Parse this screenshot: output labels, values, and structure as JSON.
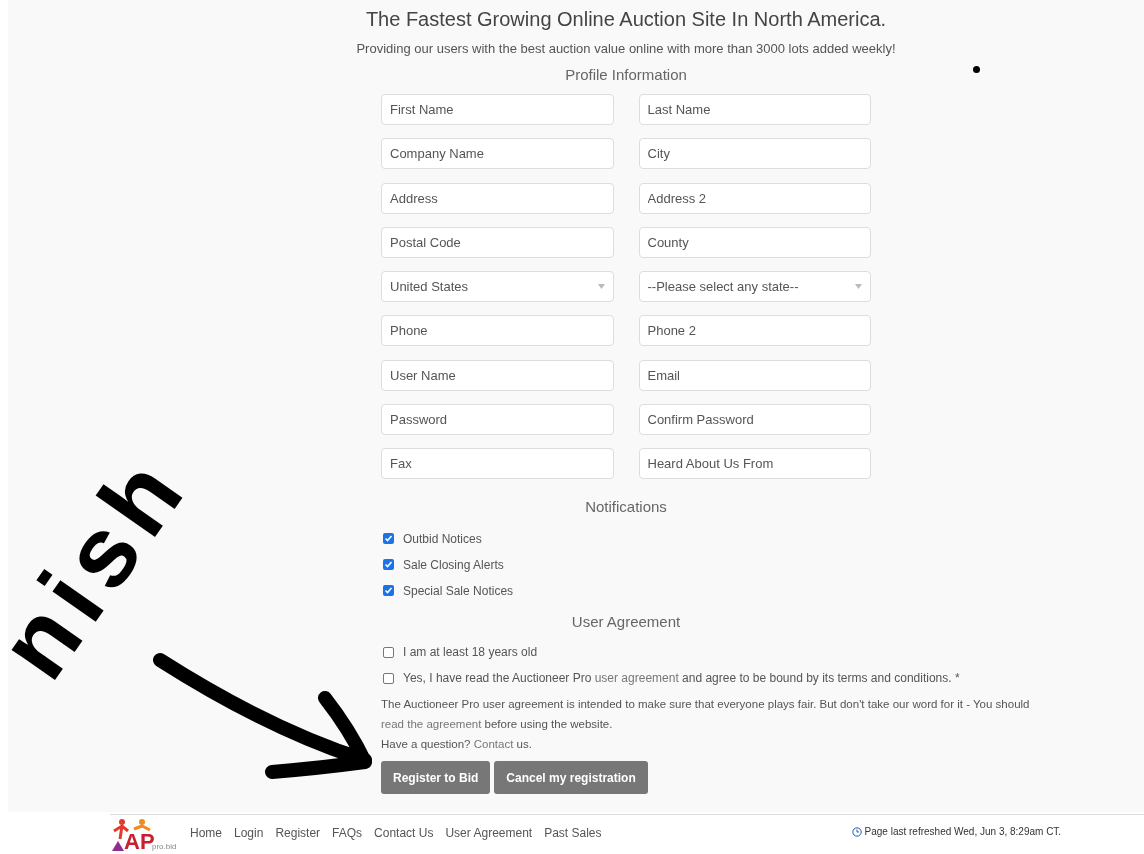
{
  "header": {
    "title": "The Fastest Growing Online Auction Site In North America.",
    "subtitle": "Providing our users with the best auction value online with more than 3000 lots added weekly!"
  },
  "profile": {
    "heading": "Profile Information",
    "fields": [
      {
        "kind": "text",
        "placeholder": "First Name"
      },
      {
        "kind": "text",
        "placeholder": "Last Name"
      },
      {
        "kind": "text",
        "placeholder": "Company Name"
      },
      {
        "kind": "text",
        "placeholder": "City"
      },
      {
        "kind": "text",
        "placeholder": "Address"
      },
      {
        "kind": "text",
        "placeholder": "Address 2"
      },
      {
        "kind": "text",
        "placeholder": "Postal Code"
      },
      {
        "kind": "text",
        "placeholder": "County"
      },
      {
        "kind": "select",
        "value": "United States"
      },
      {
        "kind": "select",
        "value": "--Please select any state--"
      },
      {
        "kind": "text",
        "placeholder": "Phone"
      },
      {
        "kind": "text",
        "placeholder": "Phone 2"
      },
      {
        "kind": "text",
        "placeholder": "User Name"
      },
      {
        "kind": "text",
        "placeholder": "Email"
      },
      {
        "kind": "text",
        "placeholder": "Password"
      },
      {
        "kind": "text",
        "placeholder": "Confirm Password"
      },
      {
        "kind": "text",
        "placeholder": "Fax"
      },
      {
        "kind": "text",
        "placeholder": "Heard About Us From"
      }
    ]
  },
  "notifications": {
    "heading": "Notifications",
    "items": [
      {
        "label": "Outbid Notices",
        "checked": true
      },
      {
        "label": "Sale Closing Alerts",
        "checked": true
      },
      {
        "label": "Special Sale Notices",
        "checked": true
      }
    ]
  },
  "agreement": {
    "heading": "User Agreement",
    "items": [
      {
        "parts": [
          {
            "text": "I am at least 18 years old"
          }
        ],
        "checked": false
      },
      {
        "parts": [
          {
            "text": "Yes, I have read the Auctioneer Pro "
          },
          {
            "text": "user agreement",
            "link": true
          },
          {
            "text": " and agree to be bound by its terms and conditions. *"
          }
        ],
        "checked": false
      }
    ],
    "paragraph": [
      {
        "text": "The Auctioneer Pro user agreement is intended to make sure that everyone plays fair. But don't take our word for it - You should "
      },
      {
        "text": "read the agreement",
        "link": true
      },
      {
        "text": " before using the website."
      }
    ],
    "question": [
      {
        "text": "Have a question? "
      },
      {
        "text": "Contact",
        "link": true
      },
      {
        "text": " us."
      }
    ]
  },
  "buttons": [
    "Register to Bid",
    "Cancel my registration"
  ],
  "footer": {
    "logo": {
      "mark": "AP",
      "suffix": "pro.bid"
    },
    "links": [
      "Home",
      "Login",
      "Register",
      "FAQs",
      "Contact Us",
      "User Agreement",
      "Past Sales"
    ],
    "refreshed": "Page last refreshed Wed, Jun 3, 8:29am CT."
  },
  "annotation": {
    "text": "nish"
  }
}
